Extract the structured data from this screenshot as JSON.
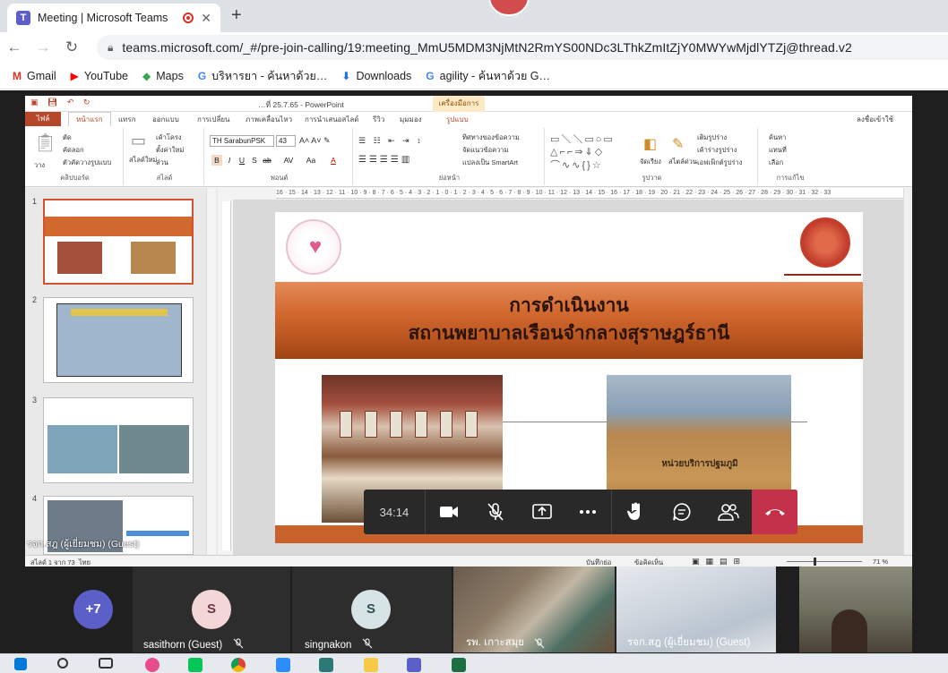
{
  "browser": {
    "tab_title": "Meeting | Microsoft Teams",
    "new_tab": "+",
    "close_tab": "✕",
    "url": "teams.microsoft.com/_#/pre-join-calling/19:meeting_MmU5MDM3NjMtN2RmYS00NDc3LThkZmItZjY0MWYwMjdlYTZj@thread.v2",
    "bookmarks": [
      {
        "label": "Gmail",
        "icon": "gmail-icon",
        "glyph": "M",
        "color": "#d93025"
      },
      {
        "label": "YouTube",
        "icon": "youtube-icon",
        "glyph": "▶",
        "color": "#ff0000"
      },
      {
        "label": "Maps",
        "icon": "maps-icon",
        "glyph": "◆",
        "color": "#34a853"
      },
      {
        "label": "บริหารยา - ค้นหาด้วย…",
        "icon": "google-icon",
        "glyph": "G",
        "color": "#4285f4"
      },
      {
        "label": "Downloads",
        "icon": "download-icon",
        "glyph": "⬇",
        "color": "#1a73e8"
      },
      {
        "label": "agility - ค้นหาด้วย G…",
        "icon": "google-icon",
        "glyph": "G",
        "color": "#4285f4"
      }
    ]
  },
  "powerpoint": {
    "doc_title": "…ที่ 25.7.65 - PowerPoint",
    "context_group": "เครื่องมือการวาด",
    "ribbon_tabs": [
      "ไฟล์",
      "หน้าแรก",
      "แทรก",
      "ออกแบบ",
      "การเปลี่ยน",
      "ภาพเคลื่อนไหว",
      "การนำเสนอสไลด์",
      "รีวิว",
      "มุมมอง",
      "รูปแบบ"
    ],
    "signin": "ลงชื่อเข้าใช้",
    "groups": {
      "clipboard": "คลิปบอร์ด",
      "slides": "สไลด์",
      "font": "ฟอนต์",
      "paragraph": "ย่อหน้า",
      "drawing": "รูปวาด",
      "editing": "การแก้ไข"
    },
    "ribbon_items": {
      "paste": "วาง",
      "cut": "ตัด",
      "copy": "คัดลอก",
      "format_painter": "ตัวคัดวางรูปแบบ",
      "new_slide": "สไลด์ใหม่",
      "layout": "เค้าโครง",
      "reset": "ตั้งค่าใหม่",
      "section": "ส่วน",
      "text_direction": "ทิศทางของข้อความ",
      "align_text": "จัดแนวข้อความ",
      "smartart": "แปลงเป็น SmartArt",
      "arrange": "จัดเรียง",
      "quick_styles": "สไตล์ด่วน",
      "shape_fill": "เติมรูปร่าง",
      "shape_outline": "เค้าร่างรูปร่าง",
      "shape_effects": "เอฟเฟ็กต์รูปร่าง",
      "find": "ค้นหา",
      "replace": "แทนที่",
      "select": "เลือก"
    },
    "font_name": "TH SarabunPSK",
    "font_size": "43",
    "ruler_marks": "16 · 15 · 14 · 13 · 12 · 11 · 10 · 9 · 8 · 7 · 6 · 5 · 4 · 3 · 2 · 1 · 0 · 1 · 2 · 3 · 4 · 5 · 6 · 7 · 8 · 9 · 10 · 11 · 12 · 13 · 14 · 15 · 16 · 17 · 18 · 19 · 20 · 21 · 22 · 23 · 24 · 25 · 26 · 27 · 28 · 29 · 30 · 31 · 32 · 33",
    "thumbnails": [
      {
        "num": "1",
        "title": "…"
      },
      {
        "num": "2",
        "title": "…"
      },
      {
        "num": "3",
        "title": "…"
      },
      {
        "num": "4",
        "title": "…"
      }
    ],
    "slide": {
      "title_line1": "การดำเนินงาน",
      "title_line2": "สถานพยาบาลเรือนจำกลางสุราษฎร์ธานี",
      "sign_text": "หน่วยบริการปฐมภูมิ"
    },
    "status": {
      "slide_count": "สไลด์ 1 จาก 73",
      "language": "ไทย",
      "notes": "บันทึกย่อ",
      "comments": "ข้อคิดเห็น",
      "zoom": "71 %"
    }
  },
  "presenter_label": "รจก.สฎ (ผู้เยี่ยมชม) (Guest)",
  "meeting": {
    "timer": "34:14",
    "buttons": [
      "camera",
      "mic-off",
      "share",
      "more",
      "raise-hand",
      "chat",
      "participants",
      "hang-up"
    ]
  },
  "participants": [
    {
      "kind": "overflow",
      "label": "+7"
    },
    {
      "kind": "avatar",
      "initial": "S",
      "name": "sasithorn (Guest)",
      "muted": true
    },
    {
      "kind": "avatar",
      "initial": "S",
      "name": "singnakon",
      "muted": true
    },
    {
      "kind": "video",
      "name": "รพ. เกาะสมุย",
      "muted": true
    },
    {
      "kind": "video",
      "name": "รจก.สฎ (ผู้เยี่ยมชม) (Guest)",
      "muted": false
    },
    {
      "kind": "video",
      "name": "",
      "muted": false
    }
  ]
}
